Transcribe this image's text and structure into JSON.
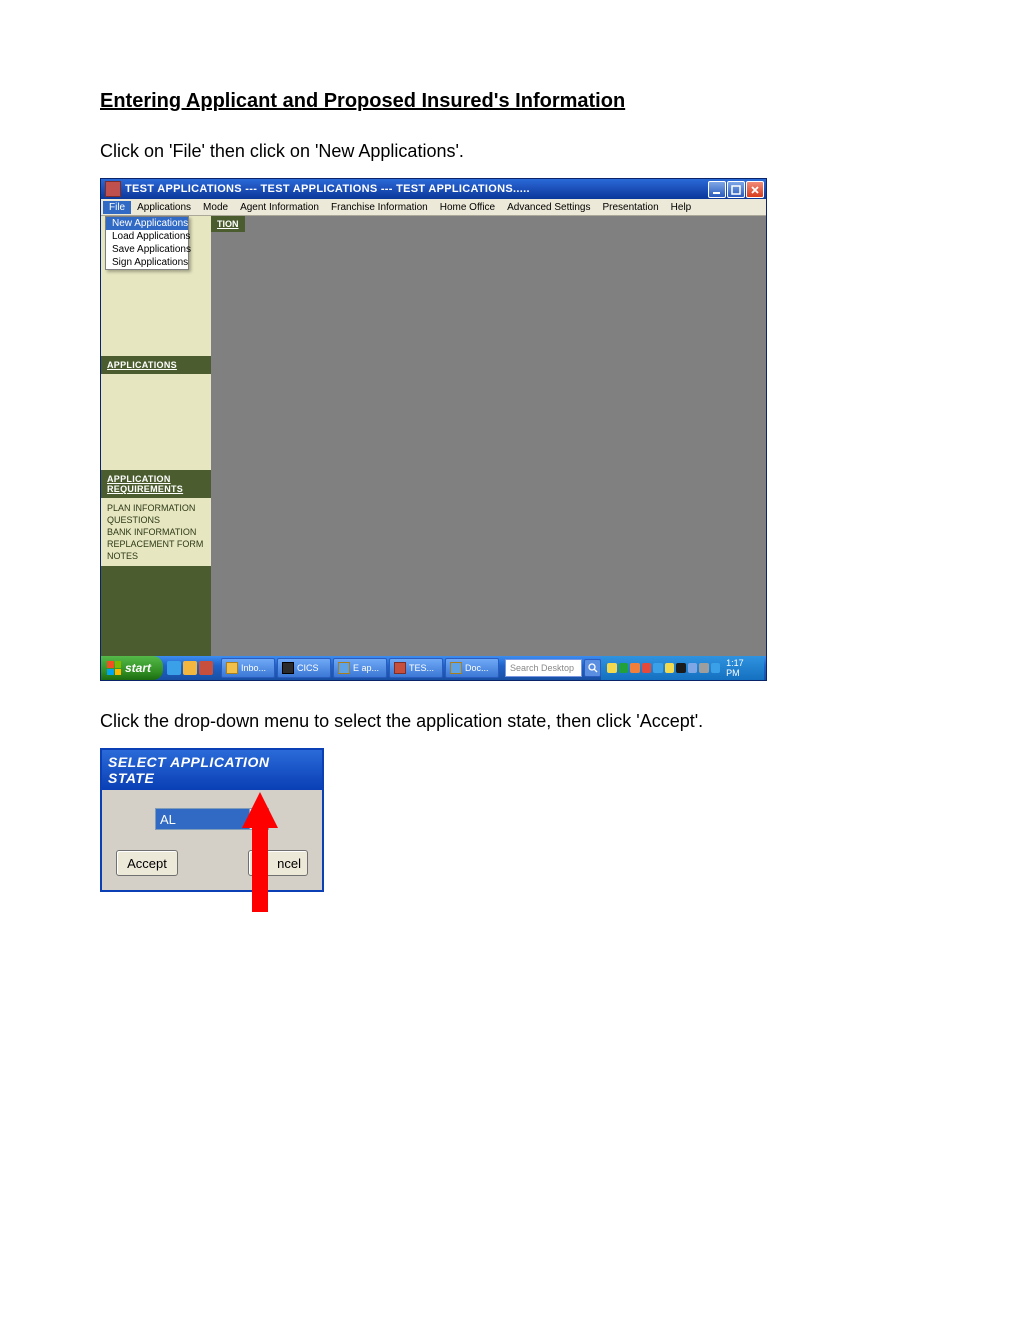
{
  "doc": {
    "heading": "Entering Applicant and Proposed Insured's Information",
    "step1": "Click on 'File' then click on 'New Applications'.",
    "step2": "Click the drop-down menu to select the application state, then click 'Accept'."
  },
  "window": {
    "title": "TEST APPLICATIONS --- TEST APPLICATIONS --- TEST APPLICATIONS.....",
    "menu": [
      "File",
      "Applications",
      "Mode",
      "Agent Information",
      "Franchise Information",
      "Home Office",
      "Advanced Settings",
      "Presentation",
      "Help"
    ],
    "file_menu": {
      "items": [
        "New Applications",
        "Load Applications",
        "Save Applications",
        "Sign Applications"
      ],
      "selected_index": 0
    },
    "sidebar": {
      "section_fragment": "TION",
      "section_applications": "APPLICATIONS",
      "section_requirements": "APPLICATION REQUIREMENTS",
      "requirements": [
        "PLAN INFORMATION",
        "QUESTIONS",
        "BANK INFORMATION",
        "REPLACEMENT FORM",
        "NOTES"
      ]
    }
  },
  "taskbar": {
    "start": "start",
    "tasks": [
      "Inbo...",
      "CICS",
      "E ap...",
      "TES...",
      "Doc..."
    ],
    "search_placeholder": "Search Desktop",
    "clock": "1:17 PM"
  },
  "dialog": {
    "title": "SELECT APPLICATION STATE",
    "value": "AL",
    "accept": "Accept",
    "cancel_visible": "ncel"
  }
}
